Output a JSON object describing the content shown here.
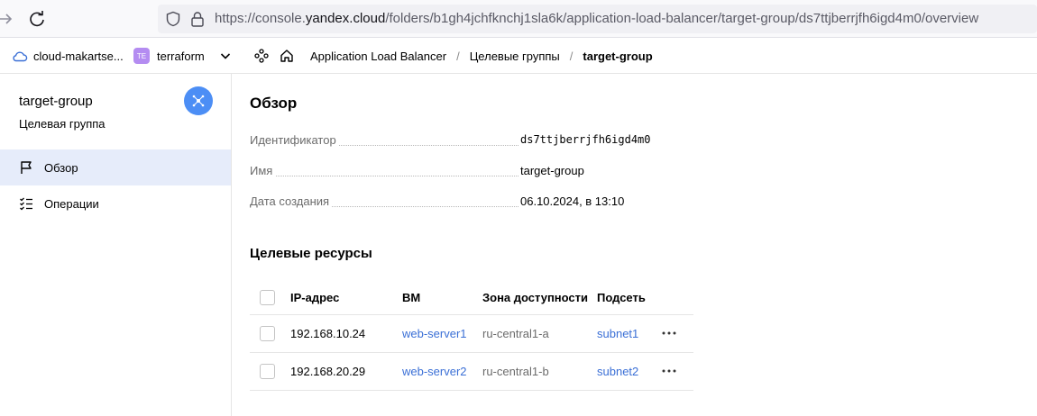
{
  "browser": {
    "url_prefix": "https://console.",
    "url_host": "yandex.cloud",
    "url_path": "/folders/b1gh4jchfknchj1sla6k/application-load-balancer/target-group/ds7ttjberrjfh6igd4m0/overview"
  },
  "header": {
    "cloud_name": "cloud-makartse...",
    "folder_badge": "TE",
    "folder_name": "terraform",
    "breadcrumbs": [
      "Application Load Balancer",
      "Целевые группы",
      "target-group"
    ],
    "separator": "/"
  },
  "sidebar": {
    "title": "target-group",
    "subtitle": "Целевая группа",
    "items": [
      {
        "label": "Обзор",
        "active": true
      },
      {
        "label": "Операции",
        "active": false
      }
    ]
  },
  "overview": {
    "heading": "Обзор",
    "fields": [
      {
        "key": "Идентификатор",
        "value": "ds7ttjberrjfh6igd4m0"
      },
      {
        "key": "Имя",
        "value": "target-group"
      },
      {
        "key": "Дата создания",
        "value": "06.10.2024, в 13:10"
      }
    ]
  },
  "resources": {
    "heading": "Целевые ресурсы",
    "columns": [
      "IP-адрес",
      "ВМ",
      "Зона доступности",
      "Подсеть"
    ],
    "rows": [
      {
        "ip": "192.168.10.24",
        "vm": "web-server1",
        "zone": "ru-central1-a",
        "subnet": "subnet1"
      },
      {
        "ip": "192.168.20.29",
        "vm": "web-server2",
        "zone": "ru-central1-b",
        "subnet": "subnet2"
      }
    ]
  },
  "colors": {
    "accent": "#4c8ef5",
    "link": "#3a6fd6",
    "active_bg": "#e6ecfa",
    "badge": "#b48cf1"
  }
}
